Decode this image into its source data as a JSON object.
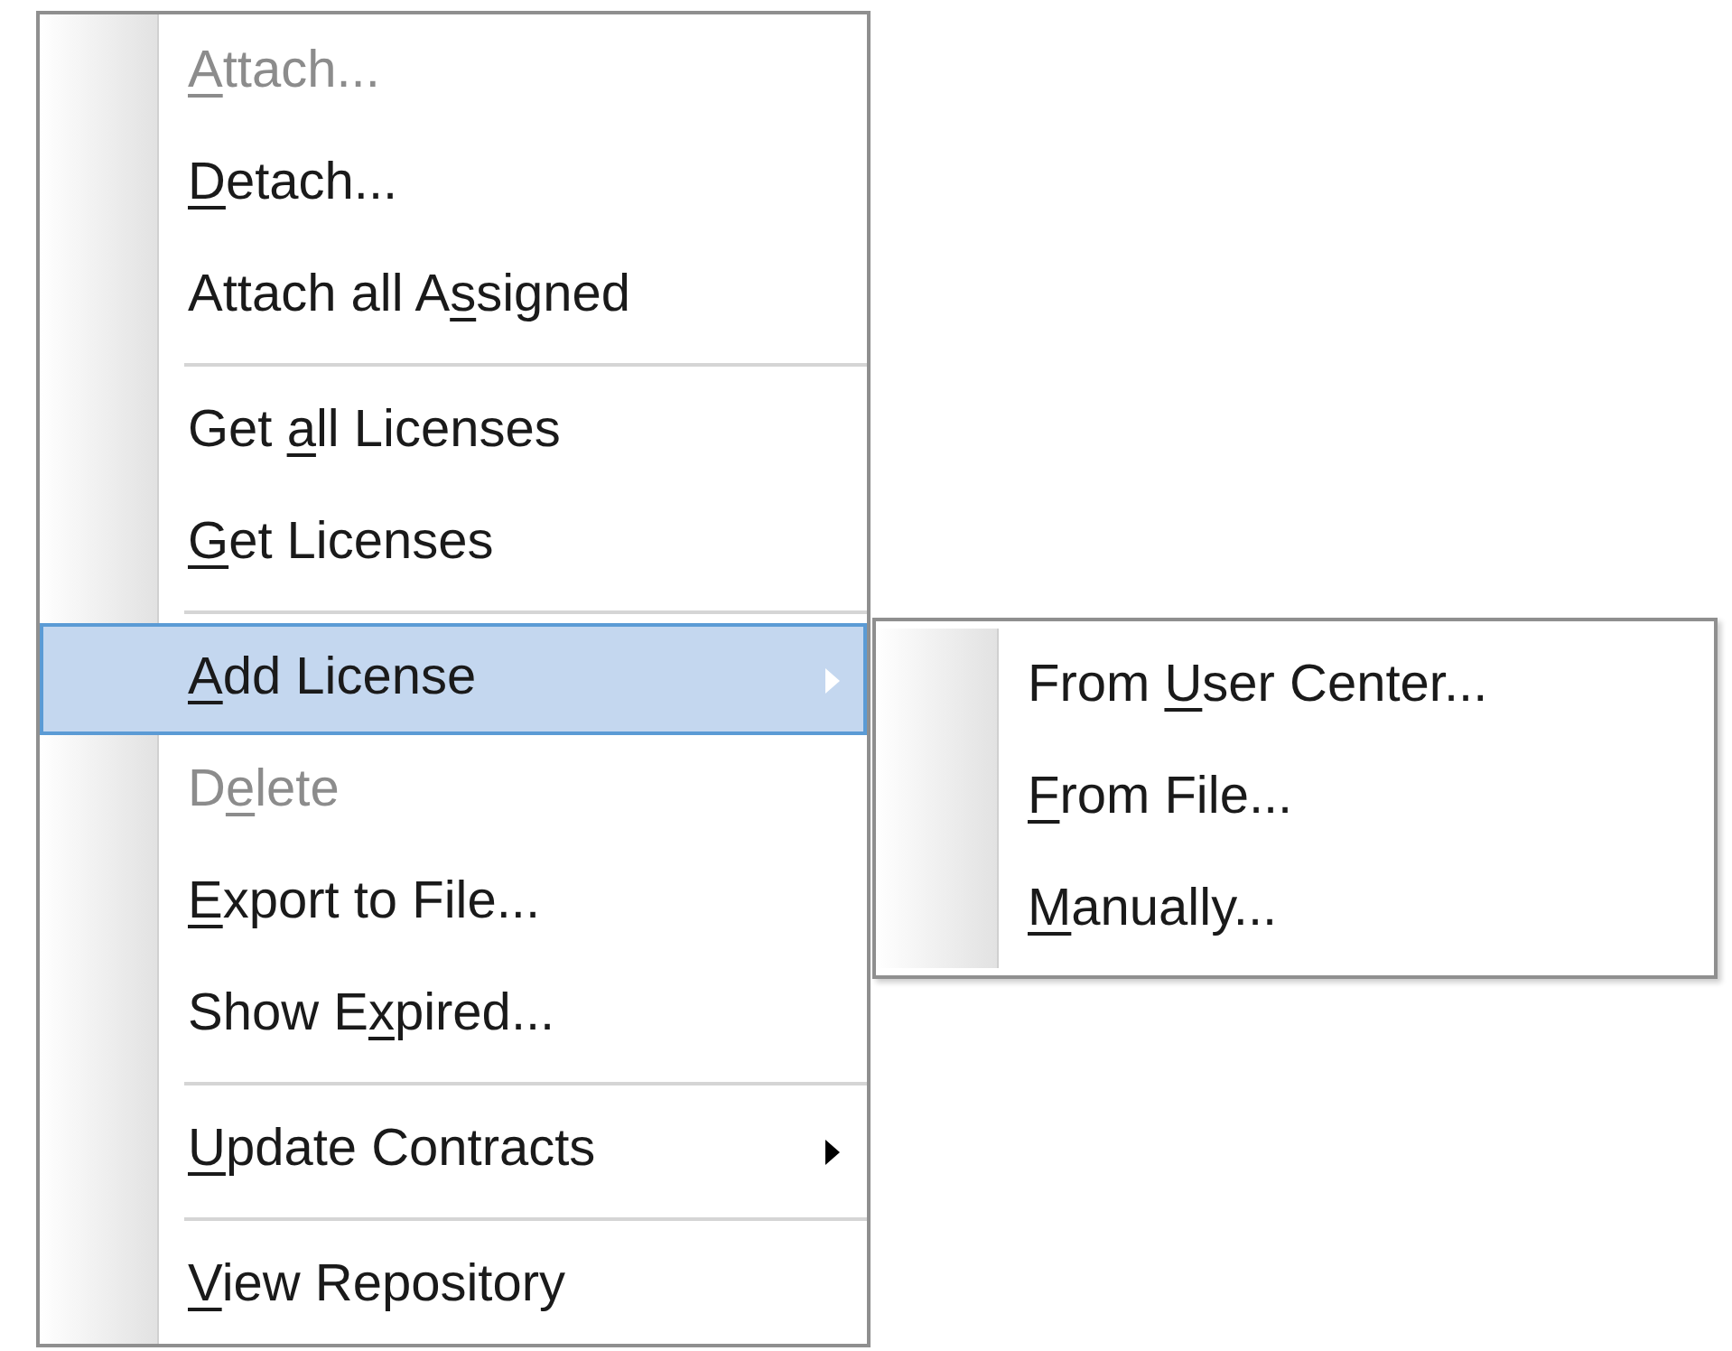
{
  "menu": {
    "items": [
      {
        "kind": "item",
        "mnemonic": "A",
        "after": "ttach...",
        "disabled": true,
        "selected": false,
        "submenu": false
      },
      {
        "kind": "item",
        "mnemonic": "D",
        "after": "etach...",
        "disabled": false,
        "selected": false,
        "submenu": false
      },
      {
        "kind": "item",
        "before": "Attach all A",
        "mnemonic": "s",
        "after": "signed",
        "disabled": false,
        "selected": false,
        "submenu": false
      },
      {
        "kind": "separator"
      },
      {
        "kind": "item",
        "before": "Get ",
        "mnemonic": "a",
        "after": "ll Licenses",
        "disabled": false,
        "selected": false,
        "submenu": false
      },
      {
        "kind": "item",
        "mnemonic": "G",
        "after": "et Licenses",
        "disabled": false,
        "selected": false,
        "submenu": false
      },
      {
        "kind": "separator"
      },
      {
        "kind": "item",
        "mnemonic": "A",
        "after": "dd License",
        "disabled": false,
        "selected": true,
        "submenu": true
      },
      {
        "kind": "item",
        "before": "D",
        "mnemonic": "e",
        "after": "lete",
        "disabled": true,
        "selected": false,
        "submenu": false
      },
      {
        "kind": "item",
        "mnemonic": "E",
        "after": "xport to File...",
        "disabled": false,
        "selected": false,
        "submenu": false
      },
      {
        "kind": "item",
        "before": "Show E",
        "mnemonic": "x",
        "after": "pired...",
        "disabled": false,
        "selected": false,
        "submenu": false
      },
      {
        "kind": "separator"
      },
      {
        "kind": "item",
        "mnemonic": "U",
        "after": "pdate Contracts",
        "disabled": false,
        "selected": false,
        "submenu": true
      },
      {
        "kind": "separator"
      },
      {
        "kind": "item",
        "mnemonic": "V",
        "after": "iew Repository",
        "disabled": false,
        "selected": false,
        "submenu": false
      }
    ]
  },
  "submenu": {
    "items": [
      {
        "kind": "item",
        "before": "From ",
        "mnemonic": "U",
        "after": "ser Center...",
        "disabled": false,
        "selected": false,
        "submenu": false
      },
      {
        "kind": "item",
        "mnemonic": "F",
        "after": "rom File...",
        "disabled": false,
        "selected": false,
        "submenu": false
      },
      {
        "kind": "item",
        "mnemonic": "M",
        "after": "anually...",
        "disabled": false,
        "selected": false,
        "submenu": false
      }
    ]
  }
}
